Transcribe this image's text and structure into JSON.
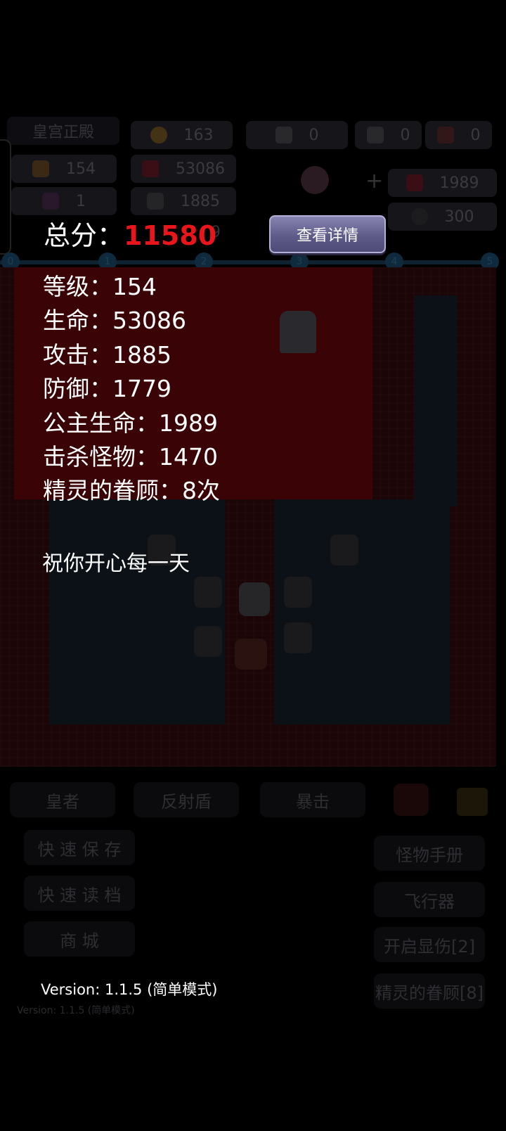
{
  "background": {
    "location": "皇宫正殿",
    "hud": {
      "gold": "163",
      "key_yellow": "0",
      "key_blue": "0",
      "key_red": "0",
      "level": "154",
      "hp": "53086",
      "attack": "1885",
      "defense_partial": "9",
      "potion": "1",
      "plus": "+",
      "princess_hp": "1989",
      "shield": "300"
    },
    "floor_markers": [
      "0",
      "1",
      "2",
      "3",
      "4",
      "5"
    ],
    "skills": [
      "皇者",
      "反射盾",
      "暴击"
    ],
    "left_buttons": [
      "快 速 保 存",
      "快 速 读 档",
      "商    城"
    ],
    "right_buttons": [
      "怪物手册",
      "飞行器",
      "开启显伤[2]",
      "精灵的眷顾[8]"
    ],
    "version": "Version: 1.1.5 (简单模式)"
  },
  "overlay": {
    "score_label": "总分：",
    "score_value": "11580",
    "details_button": "查看详情",
    "stats": [
      "等级：154",
      "生命：53086",
      "攻击：1885",
      "防御：1779",
      "公主生命：1989",
      "击杀怪物：1470",
      "精灵的眷顾：8次"
    ],
    "blessing": "祝你开心每一天",
    "version": "Version: 1.1.5 (简单模式)"
  },
  "colors": {
    "score": "#e8151b",
    "button_top": "#8884b2",
    "button_bottom": "#4e4b78",
    "map_red": "#3a0306"
  }
}
